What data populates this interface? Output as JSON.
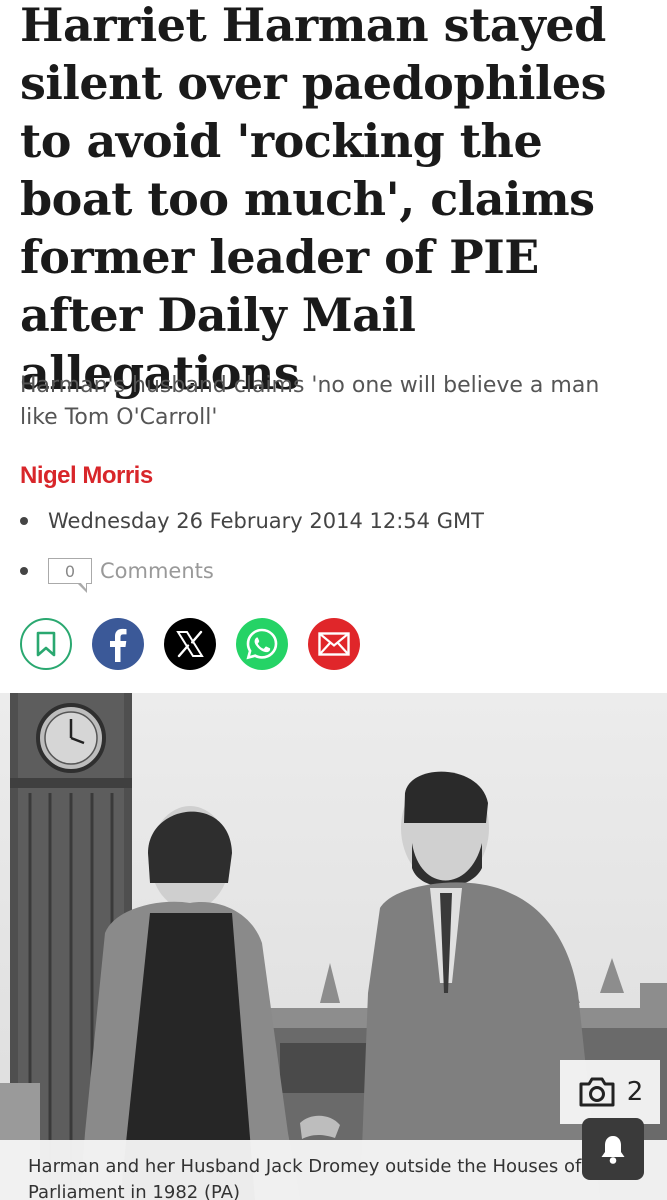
{
  "article": {
    "headline": "Harriet Harman stayed silent over paedophiles to avoid 'rocking the boat too much', claims former leader of PIE after Daily Mail allegations",
    "standfirst": "Harman's husband claims 'no one will believe a man like Tom O'Carroll'",
    "author": "Nigel Morris",
    "date": "Wednesday 26 February 2014 12:54 GMT",
    "comment_count": "0",
    "comments_label": "Comments"
  },
  "share": {
    "buttons": [
      {
        "icon": "bookmark-icon",
        "color": "#2aa870"
      },
      {
        "icon": "facebook-icon",
        "color": "#3b5998"
      },
      {
        "icon": "x-icon",
        "color": "#000000"
      },
      {
        "icon": "whatsapp-icon",
        "color": "#25d366"
      },
      {
        "icon": "email-icon",
        "color": "#e0262a"
      }
    ]
  },
  "photo": {
    "gallery_count": "2",
    "caption": "Harman and her Husband Jack Dromey outside the Houses of Parliament in 1982 (PA)"
  },
  "colors": {
    "accent": "#d8262a",
    "text": "#1a1a1a",
    "muted": "#555555"
  }
}
